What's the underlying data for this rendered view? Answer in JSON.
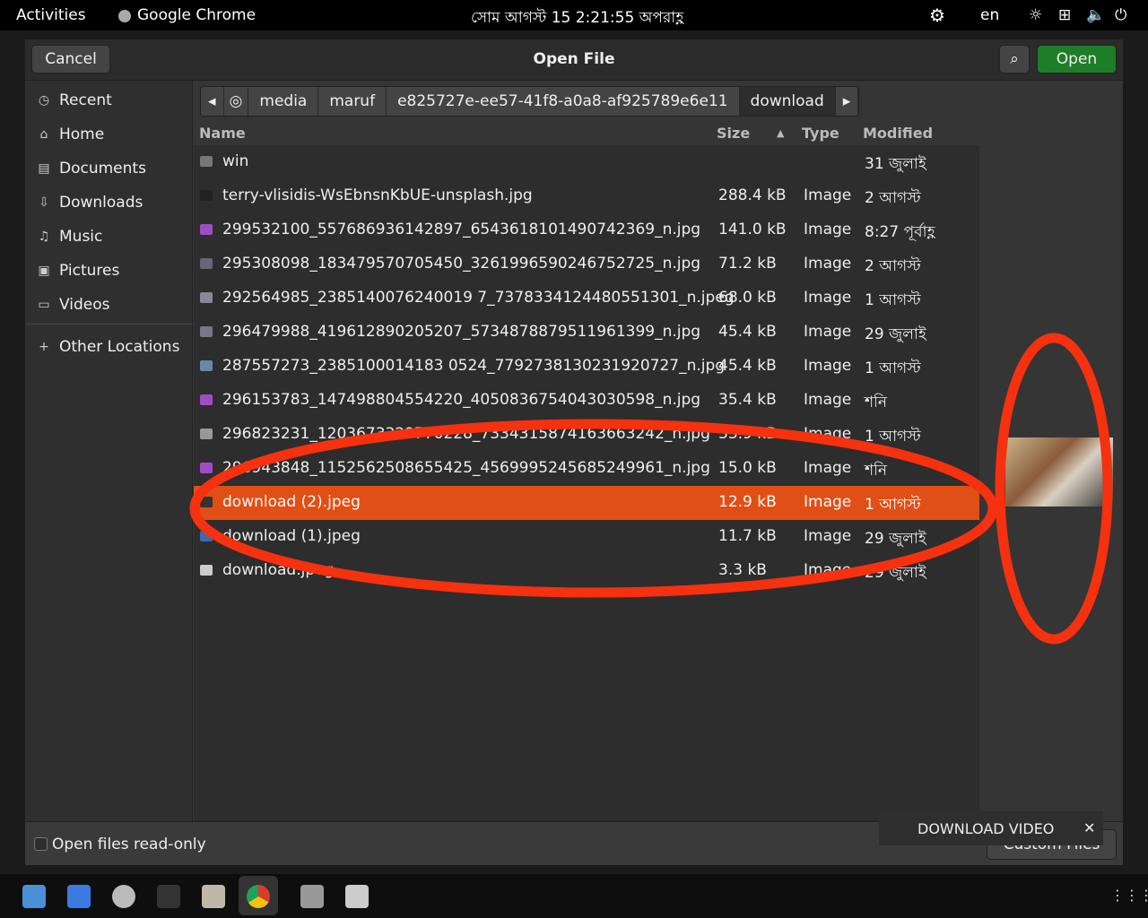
{
  "topbar": {
    "activities": "Activities",
    "app": "Google Chrome",
    "clock": "সোম আগস্ট 15  2:21:55 অপরাহ্ণ",
    "lang": "en"
  },
  "dialog": {
    "title": "Open File",
    "cancel": "Cancel",
    "open": "Open",
    "read_only": "Open files read-only",
    "filter": "Custom Files"
  },
  "sidebar": [
    {
      "label": "Recent",
      "icon": "clock-icon"
    },
    {
      "label": "Home",
      "icon": "home-icon"
    },
    {
      "label": "Documents",
      "icon": "document-icon"
    },
    {
      "label": "Downloads",
      "icon": "download-icon"
    },
    {
      "label": "Music",
      "icon": "music-icon"
    },
    {
      "label": "Pictures",
      "icon": "picture-icon"
    },
    {
      "label": "Videos",
      "icon": "video-icon"
    },
    {
      "label": "Other Locations",
      "icon": "plus-icon"
    }
  ],
  "path": [
    "media",
    "maruf",
    "e825727e-ee57-41f8-a0a8-af925789e6e11",
    "download"
  ],
  "columns": {
    "name": "Name",
    "size": "Size",
    "type": "Type",
    "modified": "Modified"
  },
  "files": [
    {
      "name": "win",
      "size": "",
      "type": "",
      "modified": "31 জুলাই",
      "folder": true
    },
    {
      "name": "terry-vlisidis-WsEbnsnKbUE-unsplash.jpg",
      "size": "288.4 kB",
      "type": "Image",
      "modified": "2 আগস্ট"
    },
    {
      "name": "299532100_557686936142897_6543618101490742369_n.jpg",
      "size": "141.0 kB",
      "type": "Image",
      "modified": "8:27 পূর্বাহ্ণ"
    },
    {
      "name": "295308098_183479570705450_3261996590246752725_n.jpg",
      "size": "71.2 kB",
      "type": "Image",
      "modified": "2 আগস্ট"
    },
    {
      "name": "292564985_2385140076240019 7_7378334124480551301_n.jpeg",
      "size": "68.0 kB",
      "type": "Image",
      "modified": "1 আগস্ট"
    },
    {
      "name": "296479988_419612890205207_5734878879511961399_n.jpg",
      "size": "45.4 kB",
      "type": "Image",
      "modified": "29 জুলাই"
    },
    {
      "name": "287557273_2385100014183 0524_7792738130231920727_n.jpg",
      "size": "45.4 kB",
      "type": "Image",
      "modified": "1 আগস্ট"
    },
    {
      "name": "296153783_147498804554220_4050836754043030598_n.jpg",
      "size": "35.4 kB",
      "type": "Image",
      "modified": "শনি"
    },
    {
      "name": "296823231_1203673329770228_7334315874163663242_n.jpg",
      "size": "33.9 kB",
      "type": "Image",
      "modified": "1 আগস্ট"
    },
    {
      "name": "296943848_1152562508655425_4569995245685249961_n.jpg",
      "size": "15.0 kB",
      "type": "Image",
      "modified": "শনি"
    },
    {
      "name": "download (2).jpeg",
      "size": "12.9 kB",
      "type": "Image",
      "modified": "1 আগস্ট",
      "selected": true
    },
    {
      "name": "download (1).jpeg",
      "size": "11.7 kB",
      "type": "Image",
      "modified": "29 জুলাই"
    },
    {
      "name": "download.jpeg",
      "size": "3.3 kB",
      "type": "Image",
      "modified": "29 জুলাই"
    }
  ],
  "toast": {
    "label": "DOWNLOAD VIDEO",
    "close": "✕"
  },
  "colors": {
    "accent": "#e04f16",
    "open": "#1e7e28",
    "annotation": "#f5310f"
  }
}
